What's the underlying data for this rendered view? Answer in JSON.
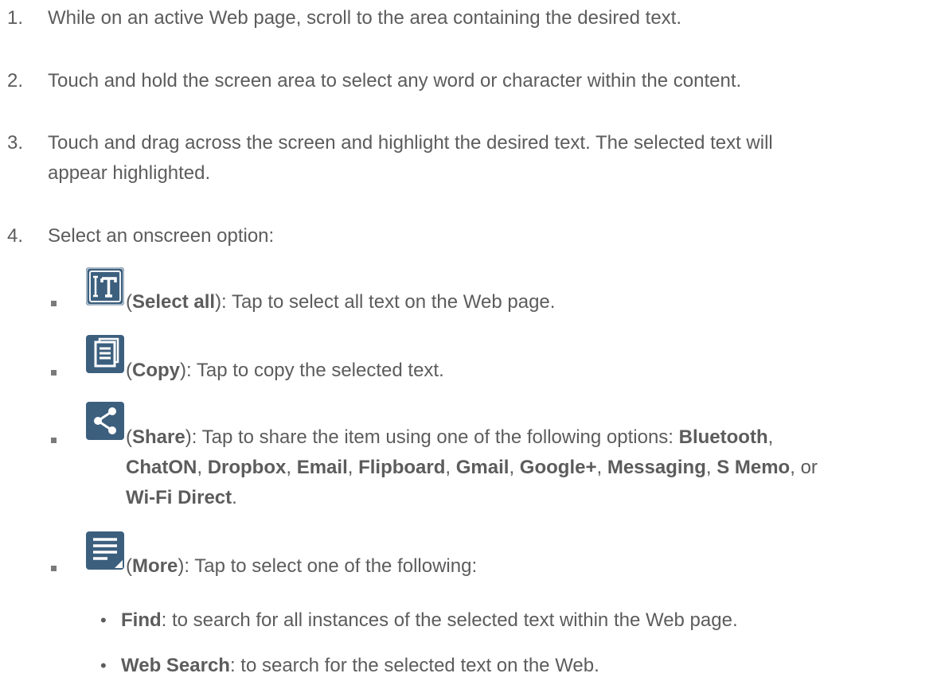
{
  "steps": [
    {
      "num": "1.",
      "text": "While on an active Web page, scroll to the area containing the desired text."
    },
    {
      "num": "2.",
      "text": "Touch and hold the screen area to select any word or character within the content."
    },
    {
      "num": "3.",
      "text_line1": "Touch and drag across the screen and highlight the desired text. The selected text will",
      "text_line2": "appear highlighted."
    },
    {
      "num": "4.",
      "text": "Select an onscreen option:"
    }
  ],
  "options": [
    {
      "icon": "select-all-icon",
      "open": "(",
      "label": "Select all",
      "rest": "): Tap to select all text on the Web page."
    },
    {
      "icon": "copy-icon",
      "open": "(",
      "label": "Copy",
      "rest": "): Tap to copy the selected text."
    },
    {
      "icon": "share-icon",
      "open": "(",
      "label": "Share",
      "rest": "): Tap to share the item using one of the following options: ",
      "share_options": [
        "Bluetooth",
        "ChatON",
        "Dropbox",
        "Email",
        "Flipboard",
        "Gmail",
        "Google+",
        "Messaging",
        "S Memo",
        "Wi-Fi Direct"
      ],
      "sep": ", ",
      "or": "or",
      "end": "."
    },
    {
      "icon": "more-icon",
      "open": "(",
      "label": "More",
      "rest": "): Tap to select one of the following:"
    }
  ],
  "more_items": [
    {
      "bullet": "•",
      "label": "Find",
      "rest": ": to search for all instances of the selected text within the Web page."
    },
    {
      "bullet": "•",
      "label": "Web Search",
      "rest": ": to search for the selected text on the Web."
    }
  ],
  "colors": {
    "text": "#5c5c5c",
    "icon_bg": "#3c5f7e"
  }
}
